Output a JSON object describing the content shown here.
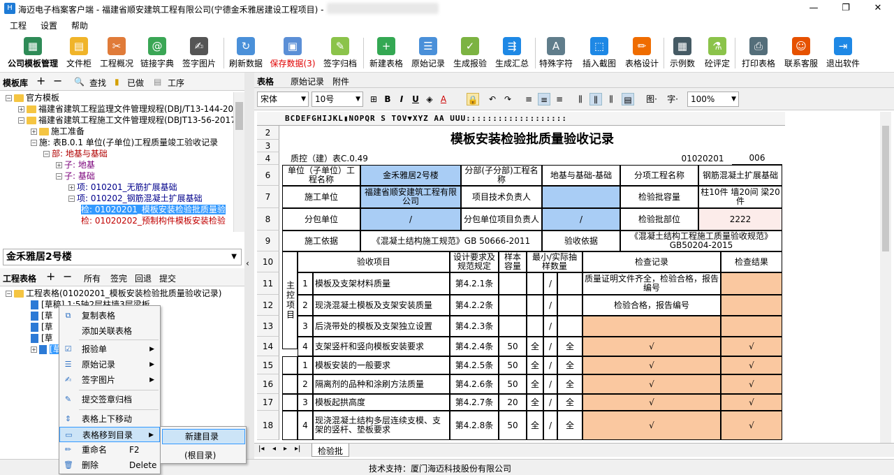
{
  "window": {
    "title": "海迈电子档案客户端 - 福建省顺安建筑工程有限公司(宁德金禾雅居建设工程项目) -",
    "minimize": "—",
    "maximize": "❐",
    "close": "✕"
  },
  "menu": [
    "工程",
    "设置",
    "帮助"
  ],
  "toolbar": [
    {
      "label": "公司模板管理",
      "icon": "company-template-icon",
      "color": "#2e8b57",
      "glyph": "▦",
      "bold": true
    },
    {
      "label": "文件柜",
      "icon": "file-cabinet-icon",
      "color": "#f0b429",
      "glyph": "▤"
    },
    {
      "label": "工程概况",
      "icon": "tools-icon",
      "color": "#e07b39",
      "glyph": "✂"
    },
    {
      "label": "链接字典",
      "icon": "link-dictionary-icon",
      "color": "#3aa655",
      "glyph": "@"
    },
    {
      "label": "签字图片",
      "icon": "signature-icon",
      "color": "#555555",
      "glyph": "✍"
    },
    {
      "label": "刷新数据",
      "icon": "refresh-icon",
      "color": "#4a90d9",
      "glyph": "↻"
    },
    {
      "label": "保存数据(3)",
      "icon": "save-icon",
      "color": "#5b8fd6",
      "glyph": "▣",
      "red": true
    },
    {
      "label": "签字归档",
      "icon": "sign-archive-icon",
      "color": "#8bc34a",
      "glyph": "✎"
    },
    {
      "label": "新建表格",
      "icon": "new-table-icon",
      "color": "#34a853",
      "glyph": "+"
    },
    {
      "label": "原始记录",
      "icon": "raw-record-icon",
      "color": "#4a90d9",
      "glyph": "☰"
    },
    {
      "label": "生成报验",
      "icon": "generate-report-icon",
      "color": "#7cb342",
      "glyph": "✓"
    },
    {
      "label": "生成汇总",
      "icon": "generate-summary-icon",
      "color": "#1e88e5",
      "glyph": "⇶"
    },
    {
      "label": "特殊字符",
      "icon": "special-char-icon",
      "color": "#607d8b",
      "glyph": "A"
    },
    {
      "label": "插入截图",
      "icon": "insert-screenshot-icon",
      "color": "#1e88e5",
      "glyph": "⬚"
    },
    {
      "label": "表格设计",
      "icon": "table-design-icon",
      "color": "#ef6c00",
      "glyph": "✏"
    },
    {
      "label": "示例数",
      "icon": "calculator-icon",
      "color": "#455a64",
      "glyph": "▦"
    },
    {
      "label": "砼评定",
      "icon": "flask-icon",
      "color": "#8bc34a",
      "glyph": "⚗"
    },
    {
      "label": "打印表格",
      "icon": "printer-icon",
      "color": "#546e7a",
      "glyph": "⎙"
    },
    {
      "label": "联系客服",
      "icon": "support-icon",
      "color": "#e65100",
      "glyph": "☺"
    },
    {
      "label": "退出软件",
      "icon": "exit-icon",
      "color": "#1e88e5",
      "glyph": "⇥"
    }
  ],
  "template_lib": {
    "title": "模板库",
    "search": "查找",
    "done": "已做",
    "procedure": "工序",
    "tree": [
      {
        "text": "官方模板",
        "indent": 0,
        "exp": "−",
        "type": "folder"
      },
      {
        "text": "福建省建筑工程监理文件管理规程(DBJ/T13-144-20",
        "indent": 1,
        "exp": "+",
        "type": "folder"
      },
      {
        "text": "福建省建筑工程施工文件管理规程(DBJT13-56-2017",
        "indent": 1,
        "exp": "−",
        "type": "folder"
      },
      {
        "text": "施工准备",
        "indent": 2,
        "exp": "+",
        "type": "folder"
      },
      {
        "text": "施: 表B.0.1  单位(子单位)工程质量竣工验收记录",
        "indent": 2,
        "exp": "−",
        "type": "none"
      },
      {
        "text": "部: 地基与基础",
        "indent": 3,
        "exp": "−",
        "type": "none",
        "color": "#b00000"
      },
      {
        "text": "子: 地基",
        "indent": 4,
        "exp": "+",
        "type": "none",
        "color": "#7a007a"
      },
      {
        "text": "子: 基础",
        "indent": 4,
        "exp": "−",
        "type": "none",
        "color": "#7a007a"
      },
      {
        "text": "项: 010201_无筋扩展基础",
        "indent": 5,
        "exp": "+",
        "type": "none",
        "color": "#00008b"
      },
      {
        "text": "项: 010202_钢筋混凝土扩展基础",
        "indent": 5,
        "exp": "−",
        "type": "none",
        "color": "#00008b"
      },
      {
        "text": "检: 01020201_模板安装检验批质量验",
        "indent": 6,
        "exp": "",
        "type": "none",
        "color": "#c00000",
        "selected": true
      },
      {
        "text": "检: 01020202_预制构件模板安装检验",
        "indent": 6,
        "exp": "",
        "type": "none",
        "color": "#c00000"
      }
    ]
  },
  "building": {
    "value": "金禾雅居2号楼"
  },
  "project_tables": {
    "title": "工程表格",
    "all": "所有",
    "finished": "签完",
    "return": "回退",
    "submit": "提交",
    "tree": [
      {
        "text": "工程表格(01020201_模板安装检验批质量验收记录)",
        "indent": 0,
        "type": "folder",
        "exp": "−"
      },
      {
        "text": "[草稿] 1:5轴2层柱墙3层梁板",
        "indent": 2,
        "type": "doc"
      },
      {
        "text": "[草",
        "indent": 2,
        "type": "doc"
      },
      {
        "text": "[草",
        "indent": 2,
        "type": "doc"
      },
      {
        "text": "[草",
        "indent": 2,
        "type": "doc"
      },
      {
        "text": "[草",
        "indent": 2,
        "type": "doc",
        "selected": true,
        "exp": "+"
      }
    ]
  },
  "tabs": [
    "表格",
    "原始记录",
    "附件"
  ],
  "format": {
    "font": "宋体",
    "size": "10号",
    "zoom": "100%",
    "fig": "图·",
    "char": "字·"
  },
  "sheet": {
    "colheader": "BCDEFGHIJKL▮NOPQR  S  TOV▼XYZ   AA  UUU:::::::::::::::::::",
    "title": "模板安装检验批质量验收记录",
    "code_label": "质控（建）表C.0.49",
    "code_value": "01020201",
    "code_num": "006",
    "unit_name_label": "单位（子单位）工程名称",
    "unit_name_value": "金禾雅居2号楼",
    "sub_part_label": "分部(子分部)工程名称",
    "sub_part_value": "地基与基础-基础",
    "item_label": "分项工程名称",
    "item_value": "钢筋混凝土扩展基础",
    "contractor_label": "施工单位",
    "contractor_value": "福建省顺安建筑工程有限公司",
    "tech_lead_label": "项目技术负责人",
    "capacity_label": "检验批容量",
    "capacity_value": "柱10件 墙20间 梁20件",
    "subcontractor_label": "分包单位",
    "subcontractor_value": "/",
    "sub_lead_label": "分包单位项目负责人",
    "sub_lead_value": "/",
    "part_label": "检验批部位",
    "part_value": "2222",
    "basis_label": "施工依据",
    "basis_value": "《混凝土结构施工规范》GB 50666-2011",
    "accept_label": "验收依据",
    "accept_value": "《混凝土结构工程施工质量验收规范》GB50204-2015",
    "header_item": "验收项目",
    "header_design": "设计要求及规范规定",
    "header_sample": "样本容量",
    "header_min": "最小/实际抽样数量",
    "header_record": "检查记录",
    "header_result": "检查结果",
    "main_label": "主控项目",
    "rows": [
      {
        "row": "11",
        "n": "1",
        "item": "模板及支架材料质量",
        "spec": "第4.2.1条",
        "cap": "",
        "full": "",
        "slash": "/",
        "act": "",
        "rec": "质量证明文件齐全，检验合格，报告编号",
        "res": "",
        "recWhite": true
      },
      {
        "row": "12",
        "n": "2",
        "item": "现浇混凝土模板及支架安装质量",
        "spec": "第4.2.2条",
        "cap": "",
        "full": "",
        "slash": "/",
        "act": "",
        "rec": "检验合格，报告编号",
        "res": "",
        "recWhite": true
      },
      {
        "row": "13",
        "n": "3",
        "item": "后浇带处的模板及支架独立设置",
        "spec": "第4.2.3条",
        "cap": "",
        "full": "",
        "slash": "/",
        "act": "",
        "rec": "",
        "res": ""
      },
      {
        "row": "14",
        "n": "4",
        "item": "支架竖杆和竖向模板安装要求",
        "spec": "第4.2.4条",
        "cap": "50",
        "full": "全",
        "slash": "/",
        "act": "全",
        "rec": "√",
        "res": "√"
      },
      {
        "row": "15",
        "n": "1",
        "item": "模板安装的一般要求",
        "spec": "第4.2.5条",
        "cap": "50",
        "full": "全",
        "slash": "/",
        "act": "全",
        "rec": "√",
        "res": "√"
      },
      {
        "row": "16",
        "n": "2",
        "item": "隔离剂的品种和涂刷方法质量",
        "spec": "第4.2.6条",
        "cap": "50",
        "full": "全",
        "slash": "/",
        "act": "全",
        "rec": "√",
        "res": "√"
      },
      {
        "row": "17",
        "n": "3",
        "item": "模板起拱高度",
        "spec": "第4.2.7条",
        "cap": "20",
        "full": "全",
        "slash": "/",
        "act": "全",
        "rec": "√",
        "res": "√"
      },
      {
        "row": "18",
        "n": "4",
        "item": "现浇混凝土结构多层连续支模、支架的竖杆、垫板要求",
        "spec": "第4.2.8条",
        "cap": "50",
        "full": "全",
        "slash": "/",
        "act": "全",
        "rec": "√",
        "res": "√"
      }
    ],
    "row_nums": [
      "2",
      "3",
      "4",
      "6",
      "7",
      "8",
      "9",
      "10"
    ]
  },
  "sheet_tab": "检验批",
  "status": "技术支持：厦门海迈科技股份有限公司",
  "context_menu": [
    {
      "label": "复制表格",
      "icon": "copy-icon",
      "glyph": "⧉"
    },
    {
      "label": "添加关联表格",
      "icon": "add-link-icon",
      "glyph": ""
    },
    {
      "label": "报验单",
      "icon": "report-icon",
      "glyph": "☑",
      "sub": true
    },
    {
      "label": "原始记录",
      "icon": "raw-record-icon",
      "glyph": "☰",
      "sub": true
    },
    {
      "label": "签字图片",
      "icon": "signature-icon",
      "glyph": "✍",
      "sub": true
    },
    {
      "label": "提交签章归档",
      "icon": "submit-sign-icon",
      "glyph": "✎"
    },
    {
      "label": "表格上下移动",
      "icon": "move-updown-icon",
      "glyph": "⇕"
    },
    {
      "label": "表格移到目录",
      "icon": "move-to-folder-icon",
      "glyph": "▭",
      "sub": true,
      "highlight": true
    },
    {
      "label": "重命名",
      "icon": "rename-icon",
      "glyph": "✏",
      "key": "F2"
    },
    {
      "label": "删除",
      "icon": "delete-icon",
      "glyph": "🗑",
      "key": "Delete"
    }
  ],
  "submenu": [
    "新建目录",
    "(根目录)"
  ]
}
